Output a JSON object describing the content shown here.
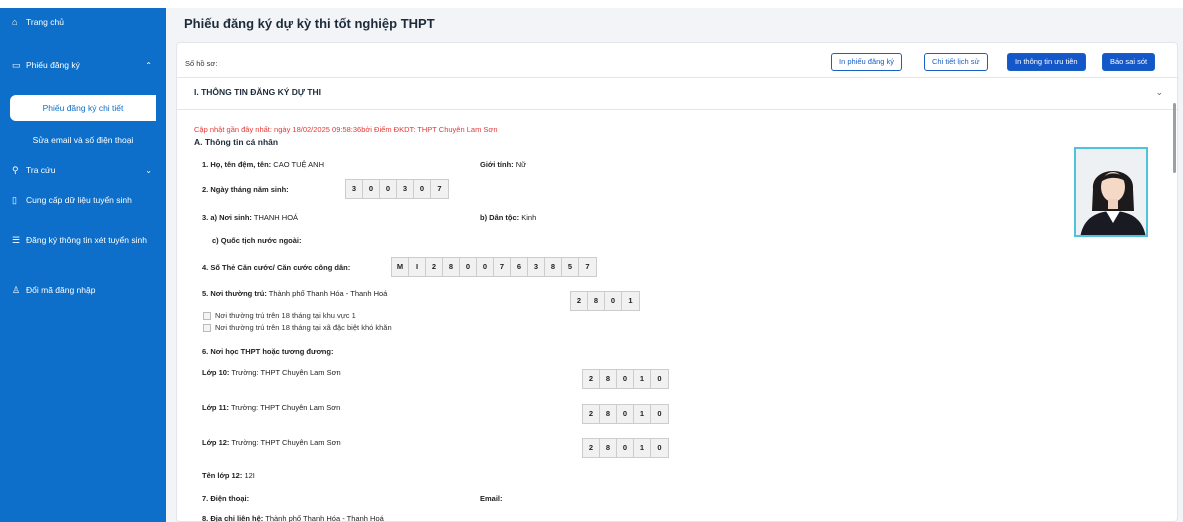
{
  "sidebar": {
    "items": [
      {
        "label": "Trang chủ",
        "icon": "home-icon"
      },
      {
        "label": "Phiếu đăng ký",
        "icon": "folder-icon"
      },
      {
        "label": "Phiếu đăng ký chi tiết"
      },
      {
        "label": "Sửa email và số điện thoại"
      },
      {
        "label": "Tra cứu",
        "icon": "search-icon"
      },
      {
        "label": "Cung cấp dữ liệu tuyển sinh",
        "icon": "file-icon"
      },
      {
        "label": "Đăng ký thông tin xét tuyển sinh",
        "icon": "list-icon"
      },
      {
        "label": "Đổi mã đăng nhập",
        "icon": "user-icon"
      }
    ]
  },
  "header": {
    "title": "Phiếu đăng ký dự kỳ thi tốt nghiệp THPT"
  },
  "toolbar": {
    "so_ho_so": "Số hồ sơ:",
    "btn_print": "In phiếu đăng ký",
    "btn_history": "Chi tiết lịch sử",
    "btn_priority": "In thông tin ưu tiên",
    "btn_report": "Báo sai sót"
  },
  "section": {
    "title": "I. THÔNG TIN ĐĂNG KÝ DỰ THI",
    "updated": "Cập nhật gần đây nhất: ngày 18/02/2025 09:58:36bởi Điểm ĐKDT: THPT Chuyên Lam Sơn",
    "sub_title": "A. Thông tin cá nhân"
  },
  "form": {
    "name_label": "1. Họ, tên đệm, tên:",
    "name_value": "CAO TUỆ ANH",
    "gender_label": "Giới tính:",
    "gender_value": "Nữ",
    "dob_label": "2. Ngày tháng năm sinh:",
    "dob_digits": [
      "3",
      "0",
      "0",
      "3",
      "0",
      "7"
    ],
    "pob_label": "3. a) Nơi sinh:",
    "pob_value": "THANH HOÁ",
    "ethnic_label": "b) Dân tộc:",
    "ethnic_value": "Kinh",
    "foreign_label": "c) Quốc tịch nước ngoài:",
    "id_label": "4. Số Thẻ Căn cước/ Căn cước công dân:",
    "id_digits": [
      "M",
      "I",
      "2",
      "8",
      "0",
      "0",
      "7",
      "6",
      "3",
      "8",
      "5",
      "7"
    ],
    "residence_label": "5. Nơi thường trú:",
    "residence_value": "Thành phố Thanh Hóa - Thanh Hoá",
    "residence_digits": [
      "2",
      "8",
      "0",
      "1"
    ],
    "check1": "Nơi thường trú trên 18 tháng tại khu vực 1",
    "check2": "Nơi thường trú trên 18 tháng tại xã đặc biệt khó khăn",
    "school_label": "6. Nơi học THPT hoặc tương đương:",
    "grade10_label": "Lớp 10:",
    "grade10_value": "Trường: THPT Chuyên Lam Sơn",
    "grade11_label": "Lớp 11:",
    "grade11_value": "Trường: THPT Chuyên Lam Sơn",
    "grade12_label": "Lớp 12:",
    "grade12_value": "Trường: THPT Chuyên Lam Sơn",
    "school_digits": [
      "2",
      "8",
      "0",
      "1",
      "0"
    ],
    "class12_label": "Tên lớp 12:",
    "class12_value": "12I",
    "phone_label": "7. Điện thoại:",
    "email_label": "Email:",
    "address_label": "8. Địa chỉ liên hệ:",
    "address_value": "Thành phố Thanh Hóa - Thanh Hoá"
  }
}
